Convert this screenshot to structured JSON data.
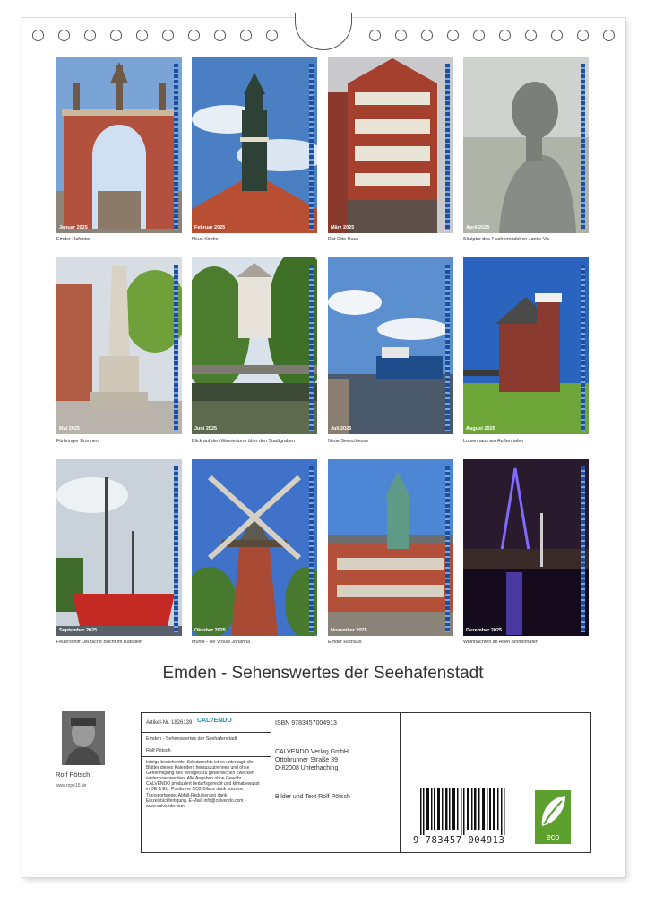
{
  "tiles": [
    {
      "month": "Januar 2025",
      "caption": "Emder Hafentor"
    },
    {
      "month": "Februar 2025",
      "caption": "Neue Kirche"
    },
    {
      "month": "März 2025",
      "caption": "Dat Otto Huus"
    },
    {
      "month": "April 2025",
      "caption": "Skulptur des Fischermädchen Jantje Vis"
    },
    {
      "month": "Mai 2025",
      "caption": "Fürbringer Brunnen"
    },
    {
      "month": "Juni 2025",
      "caption": "Blick auf den Wasserturm über den Stadtgraben"
    },
    {
      "month": "Juli 2025",
      "caption": "Neue Seeschleuse"
    },
    {
      "month": "August 2025",
      "caption": "Lotsenhaus am Außenhafen"
    },
    {
      "month": "September 2025",
      "caption": "Feuerschiff Deutsche Bucht im Ratsdelft"
    },
    {
      "month": "Oktober 2025",
      "caption": "Mühle - De Vrouw Johanna"
    },
    {
      "month": "November 2025",
      "caption": "Emder Rathaus"
    },
    {
      "month": "Dezember 2025",
      "caption": "Weihnachten im Alten Binnenhafen"
    }
  ],
  "title": "Emden - Sehenswertes der Seehafenstadt",
  "author": {
    "name": "Rolf Pötsch",
    "website": "www.rope15.de"
  },
  "info": {
    "article": "Artikel-Nr. 1826139",
    "publisher_logo": "CALVENDO",
    "calendar_title": "Emden - Sehenswertes der Seehafenstadt",
    "author_line": "Rolf Pötsch",
    "legal": "Infolge bestehender Schutzrechte ist es untersagt, die Blätter dieses Kalenders herauszutrennen und ohne Genehmigung des Verlages zu gewerblichen Zwecken weiterzuverwenden. Alle Angaben ohne Gewähr. CALVENDO produziert bedarfsgerecht und klimabewusst in DE & EU. Positivere CO2-Bilanz dank kürzerer Transportwege. Abfall-Reduzierung dank Einzelstückfertigung. E-Mail: info@calvendo.com • www.calvendo.com",
    "isbn": "ISBN 9783457004913",
    "publisher": [
      "CALVENDO Verlag GmbH",
      "Ottobrunner Straße 39",
      "D-82008 Unterhaching"
    ],
    "credits": "Bilder und Text Rolf Pötsch",
    "barcode_number": "9 783457 004913",
    "eco_label": "eco"
  },
  "colors": {
    "month_strip": "#1d4fa0",
    "eco": "#5ea02d",
    "border": "#333333"
  }
}
